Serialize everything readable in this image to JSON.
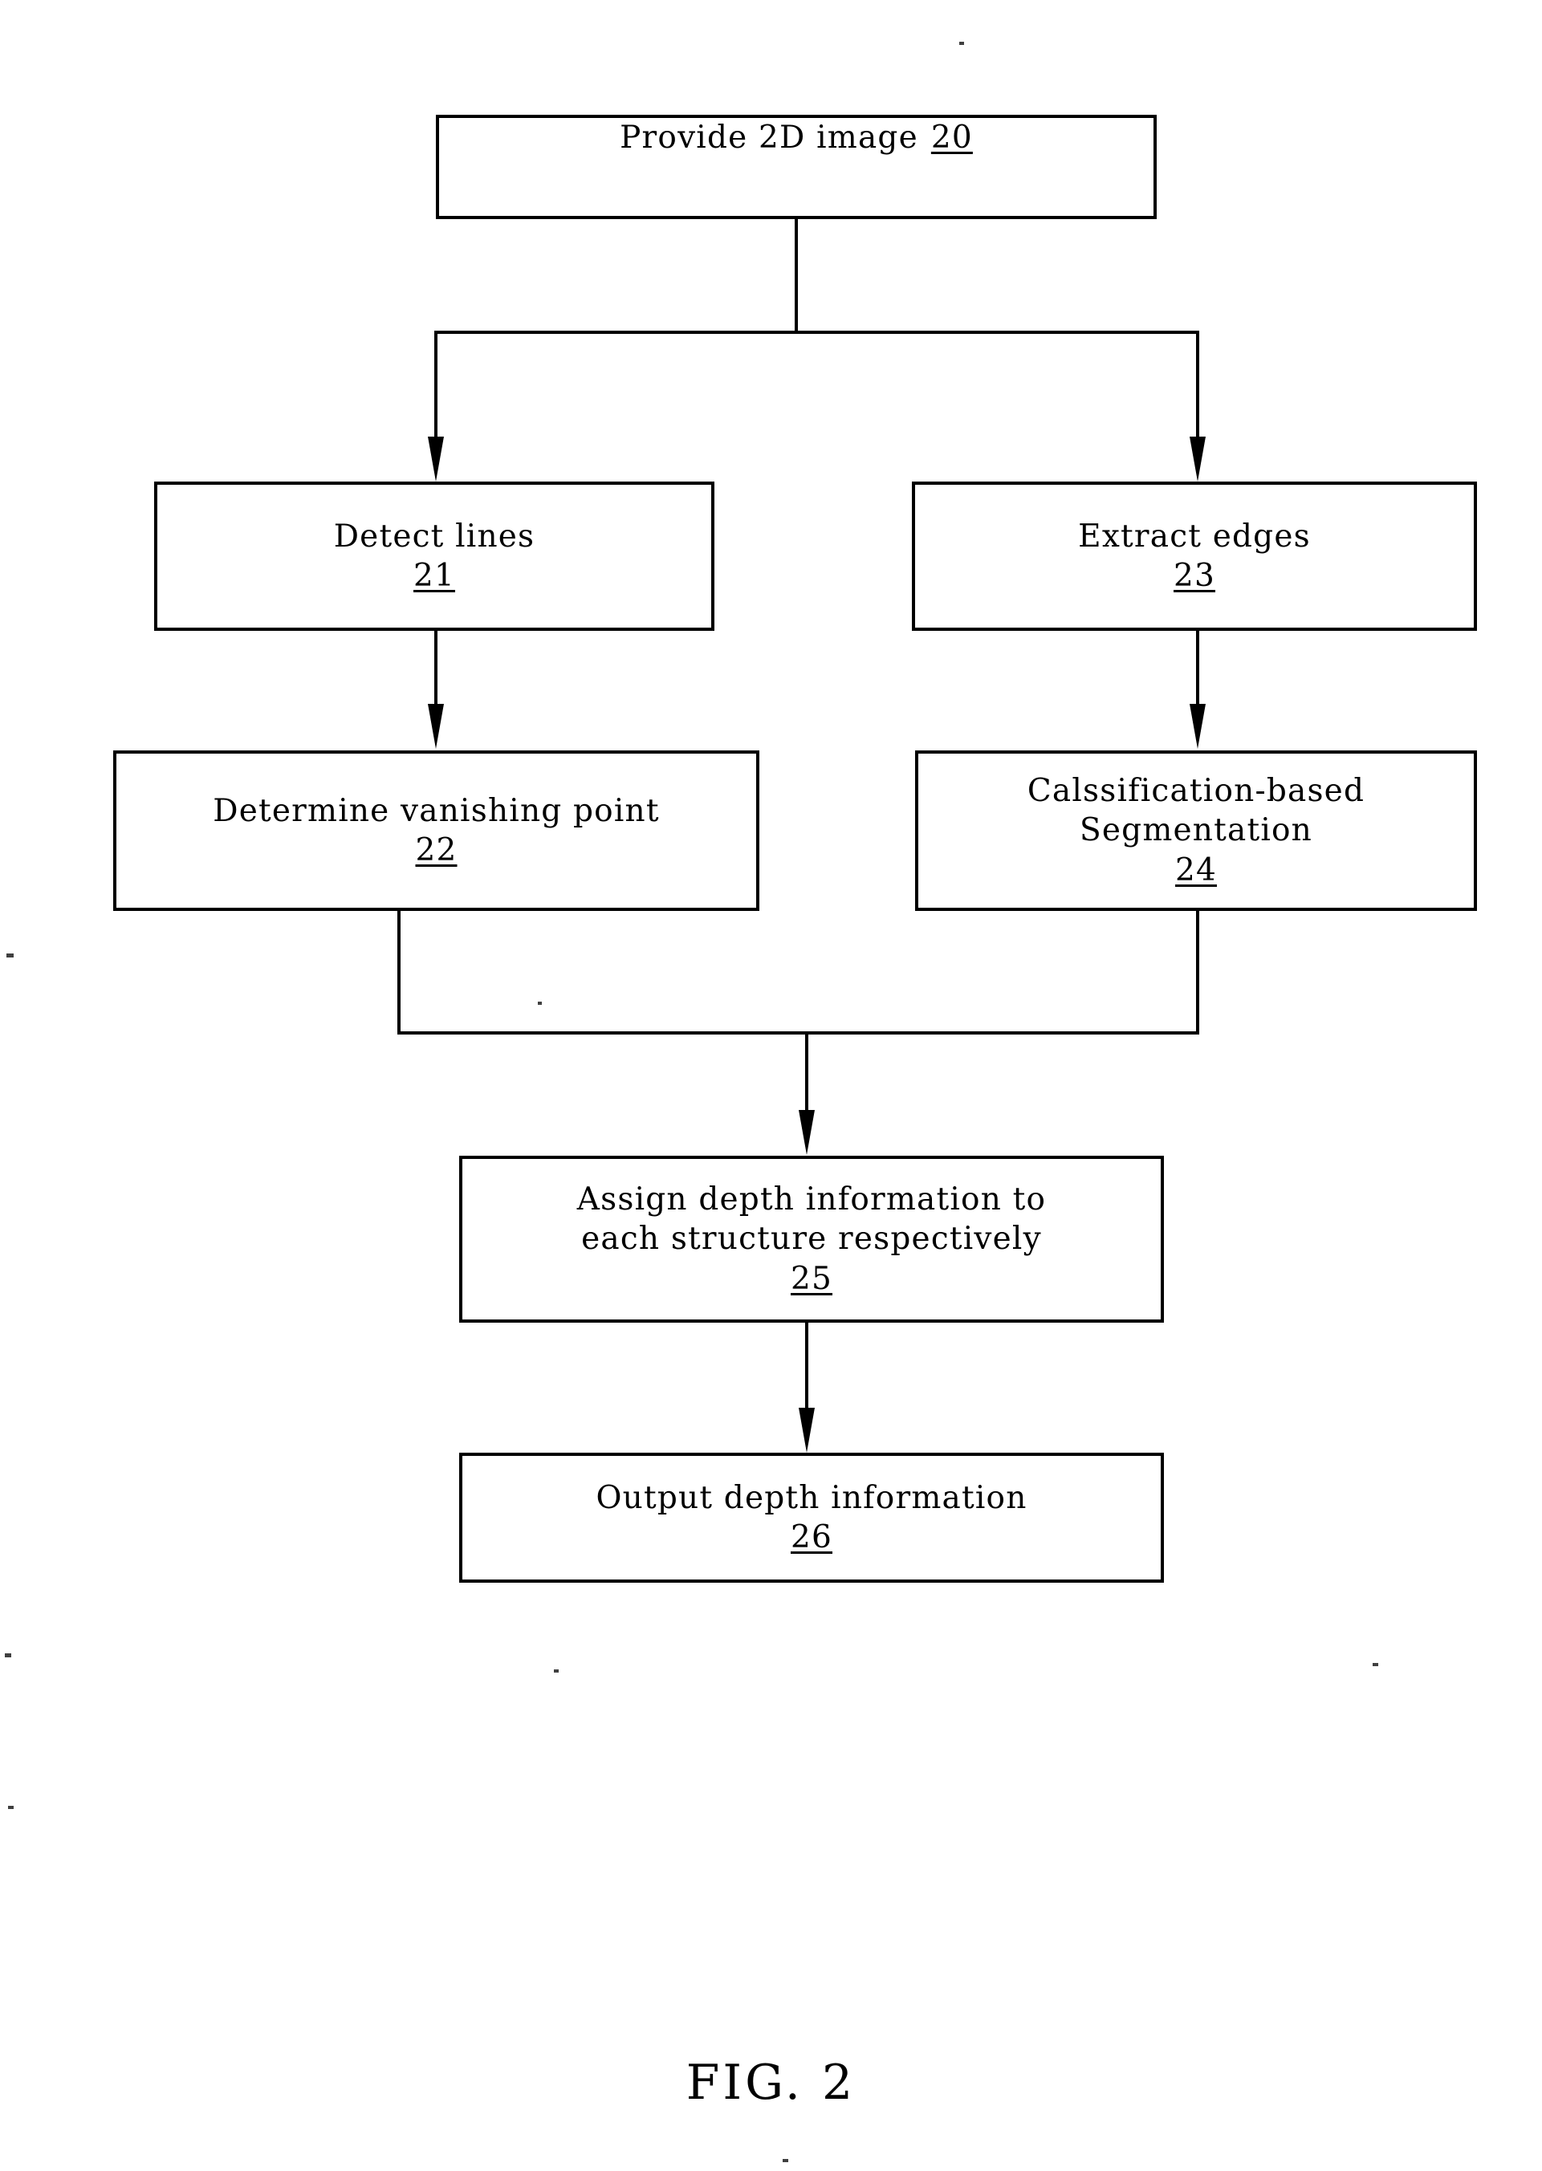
{
  "figure": {
    "caption": "FIG. 2"
  },
  "flowchart": {
    "type": "flowchart",
    "nodes": [
      {
        "id": "20",
        "ref": "20",
        "lines": [
          "Provide 2D image"
        ],
        "name": "provide-2d-image"
      },
      {
        "id": "21",
        "ref": "21",
        "lines": [
          "Detect lines"
        ],
        "name": "detect-lines"
      },
      {
        "id": "23",
        "ref": "23",
        "lines": [
          "Extract edges"
        ],
        "name": "extract-edges"
      },
      {
        "id": "22",
        "ref": "22",
        "lines": [
          "Determine vanishing point"
        ],
        "name": "determine-vanishing-point"
      },
      {
        "id": "24",
        "ref": "24",
        "lines": [
          "Calssification-based",
          "Segmentation"
        ],
        "name": "classification-based-segmentation"
      },
      {
        "id": "25",
        "ref": "25",
        "lines": [
          "Assign depth information to",
          "each structure respectively"
        ],
        "name": "assign-depth-information"
      },
      {
        "id": "26",
        "ref": "26",
        "lines": [
          "Output depth information"
        ],
        "name": "output-depth-information"
      }
    ],
    "edges": [
      {
        "from": "20",
        "to": "21"
      },
      {
        "from": "20",
        "to": "23"
      },
      {
        "from": "21",
        "to": "22"
      },
      {
        "from": "23",
        "to": "24"
      },
      {
        "from": "22",
        "to": "25"
      },
      {
        "from": "24",
        "to": "25"
      },
      {
        "from": "25",
        "to": "26"
      }
    ]
  },
  "colors": {
    "ink": "#000000",
    "paper": "#ffffff"
  }
}
